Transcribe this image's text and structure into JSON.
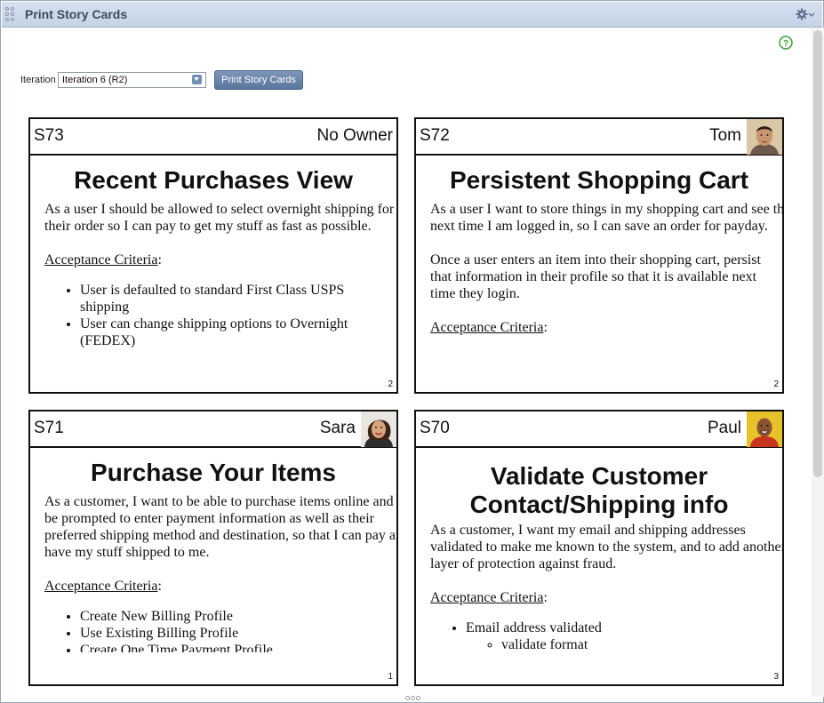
{
  "window": {
    "title": "Print Story Cards"
  },
  "controls": {
    "iteration_label": "Iteration",
    "iteration_value": "Iteration 6 (R2)",
    "print_button": "Print Story Cards"
  },
  "icons": {
    "settings": "gear-icon",
    "help": "help-icon",
    "help_color": "#3aa53a"
  },
  "cards": [
    {
      "id": "S73",
      "owner": "No Owner",
      "title": "Recent Purchases View",
      "paragraphs": [
        "As a user I should be allowed to select overnight shipping for their order so I can pay to get my stuff as fast as possible."
      ],
      "criteria_label": "Acceptance Criteria",
      "criteria": [
        "User is defaulted to standard First Class USPS shipping",
        "User can change shipping options to Overnight (FEDEX)"
      ],
      "estimate": "2"
    },
    {
      "id": "S72",
      "owner": "Tom",
      "title": "Persistent Shopping Cart",
      "paragraphs": [
        "As a user I want to store things in my shopping cart and see them next time I am logged in, so I can save an order for payday.",
        "Once a user enters an item into their shopping cart, persist that information in their profile so that it is available next time they login."
      ],
      "criteria_label": "Acceptance Criteria",
      "criteria": [],
      "estimate": "2"
    },
    {
      "id": "S71",
      "owner": "Sara",
      "title": "Purchase Your Items",
      "paragraphs": [
        "As a customer, I want to be able to purchase items online and to be prompted to enter payment information as well as their preferred shipping method and destination, so that I can pay and have my stuff shipped to me."
      ],
      "criteria_label": "Acceptance Criteria",
      "criteria": [
        "Create New Billing Profile",
        "Use Existing Billing Profile",
        "Create One Time Payment Profile"
      ],
      "estimate": "1"
    },
    {
      "id": "S70",
      "owner": "Paul",
      "title": "Validate Customer Contact/Shipping info",
      "paragraphs": [
        "As a customer, I want my email and shipping addresses validated to make me known to the system, and to add another layer of protection against fraud."
      ],
      "criteria_label": "Acceptance Criteria",
      "criteria": [
        "Email address validated"
      ],
      "sub_criteria": [
        "validate format"
      ],
      "estimate": "3"
    }
  ]
}
